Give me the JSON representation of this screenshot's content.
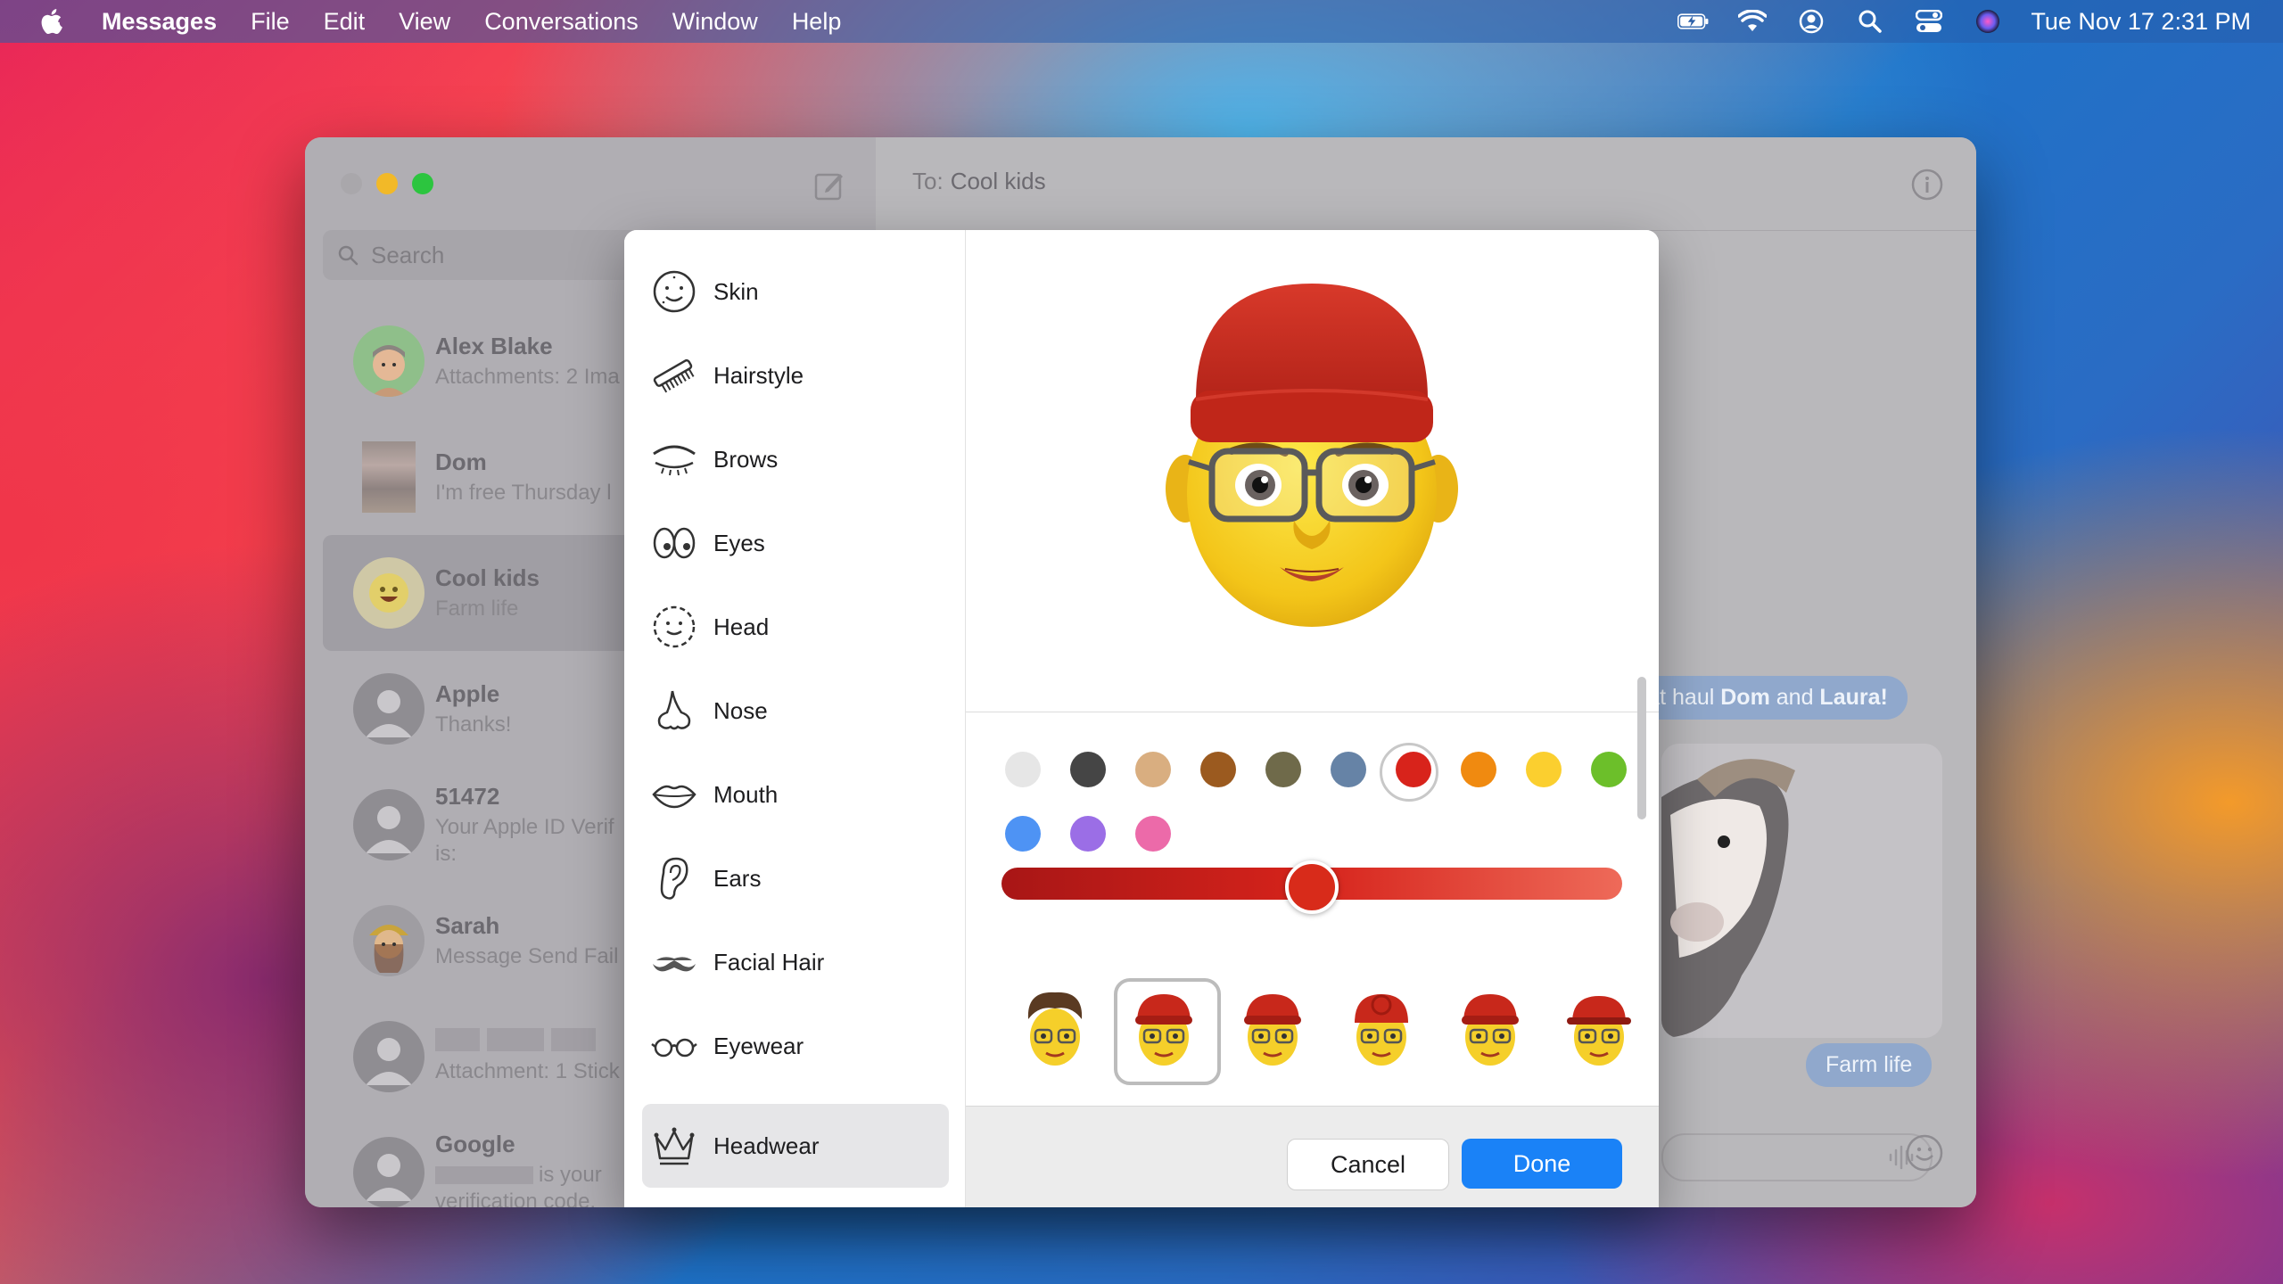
{
  "menubar": {
    "app_name": "Messages",
    "items": [
      "File",
      "Edit",
      "View",
      "Conversations",
      "Window",
      "Help"
    ],
    "clock": "Tue Nov 17  2:31 PM",
    "status_icons": [
      "battery-charging-icon",
      "wifi-icon",
      "user-icon",
      "spotlight-search-icon",
      "control-center-icon",
      "siri-icon"
    ]
  },
  "window": {
    "search_placeholder": "Search",
    "to_label": "To:",
    "to_value": "Cool kids",
    "conversations": [
      {
        "name": "Alex Blake",
        "preview": "Attachments: 2 Ima"
      },
      {
        "name": "Dom",
        "preview": "I'm free Thursday l"
      },
      {
        "name": "Cool kids",
        "preview": "Farm life"
      },
      {
        "name": "Apple",
        "preview": "Thanks!"
      },
      {
        "name": "51472",
        "preview": "Your Apple ID Verif",
        "preview2": "is:"
      },
      {
        "name": "Sarah",
        "preview": "Message Send Fail"
      },
      {
        "name": "",
        "preview": "Attachment: 1 Stick"
      },
      {
        "name": "Google",
        "preview": "is your",
        "preview2": "verification code."
      }
    ],
    "bubble_main": "reat haul ",
    "bubble_bold1": "Dom",
    "bubble_and": " and ",
    "bubble_bold2": "Laura!",
    "bubble_farm": "Farm life"
  },
  "memoji_editor": {
    "categories": [
      "Skin",
      "Hairstyle",
      "Brows",
      "Eyes",
      "Head",
      "Nose",
      "Mouth",
      "Ears",
      "Facial Hair",
      "Eyewear",
      "Headwear"
    ],
    "selected_category": "Headwear",
    "colors": [
      "#e6e6e6",
      "#454545",
      "#d9ae80",
      "#9b5a1f",
      "#6f6a4a",
      "#6683a6",
      "#d8231b",
      "#f08a10",
      "#fbcf2f",
      "#6cbf2a",
      "#4e93f4",
      "#9b6ee6",
      "#ec6aa9"
    ],
    "selected_color_index": 6,
    "slider_value": 0.5,
    "options_count": 6,
    "selected_option_index": 1,
    "cancel_label": "Cancel",
    "done_label": "Done"
  }
}
